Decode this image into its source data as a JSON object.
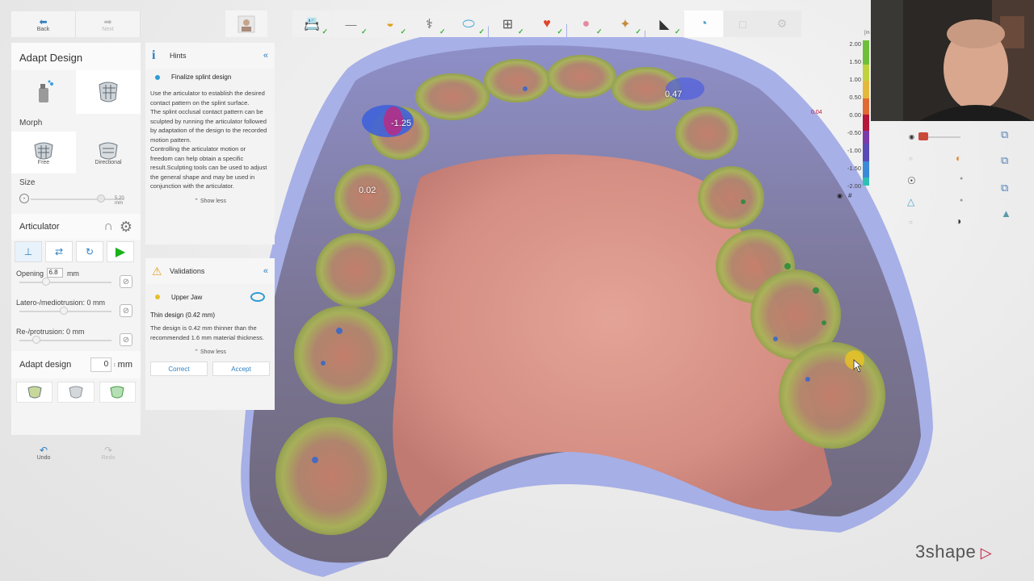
{
  "nav": {
    "back": "Back",
    "next": "Next"
  },
  "panel": {
    "title": "Adapt Design",
    "morph": "Morph",
    "morph_free": "Free",
    "morph_directional": "Directional",
    "size_label": "Size",
    "size_value": "5.20 mm",
    "articulator_label": "Articulator",
    "opening_label": "Opening",
    "opening_value": "6.8",
    "opening_unit": "mm",
    "latero_label": "Latero-/mediotrusion: 0 mm",
    "retro_label": "Re-/protrusion: 0 mm",
    "adapt_label": "Adapt design",
    "adapt_value": "0",
    "adapt_unit": "mm"
  },
  "history": {
    "undo": "Undo",
    "redo": "Redo"
  },
  "hints": {
    "title": "Hints",
    "item": "Finalize splint design",
    "body": "Use the articulator to establish the desired contact pattern on the splint surface.\nThe splint occlusal contact pattern can be sculpted by running the articulator followed by adaptation of the design to the recorded motion pattern.\nControlling the articulator motion or freedom can help obtain a specific result.Sculpting tools can be used to adjust the general shape and may be used in conjunction with the articulator.",
    "show_less": "Show less"
  },
  "validations": {
    "title": "Validations",
    "item": "Upper Jaw",
    "thin_title": "Thin design (0.42 mm)",
    "thin_body": "The design is 0.42 mm thinner than the recommended 1.6 mm material thickness.",
    "show_less": "Show less",
    "correct": "Correct",
    "accept": "Accept"
  },
  "scale": {
    "labels": [
      "2.00",
      "1.50",
      "1.00",
      "0.50",
      "0.00",
      "-0.50",
      "-1.00",
      "-1.50",
      "-2.00"
    ],
    "marker": "0.04",
    "hash": "#",
    "unit": "[m"
  },
  "contacts": {
    "a": "-1.25",
    "b": "0.47",
    "c": "0.02"
  },
  "brand": "3shape",
  "colors": {
    "accent": "#2d7fc1",
    "green": "#19b219",
    "brand": "#c4143c"
  }
}
